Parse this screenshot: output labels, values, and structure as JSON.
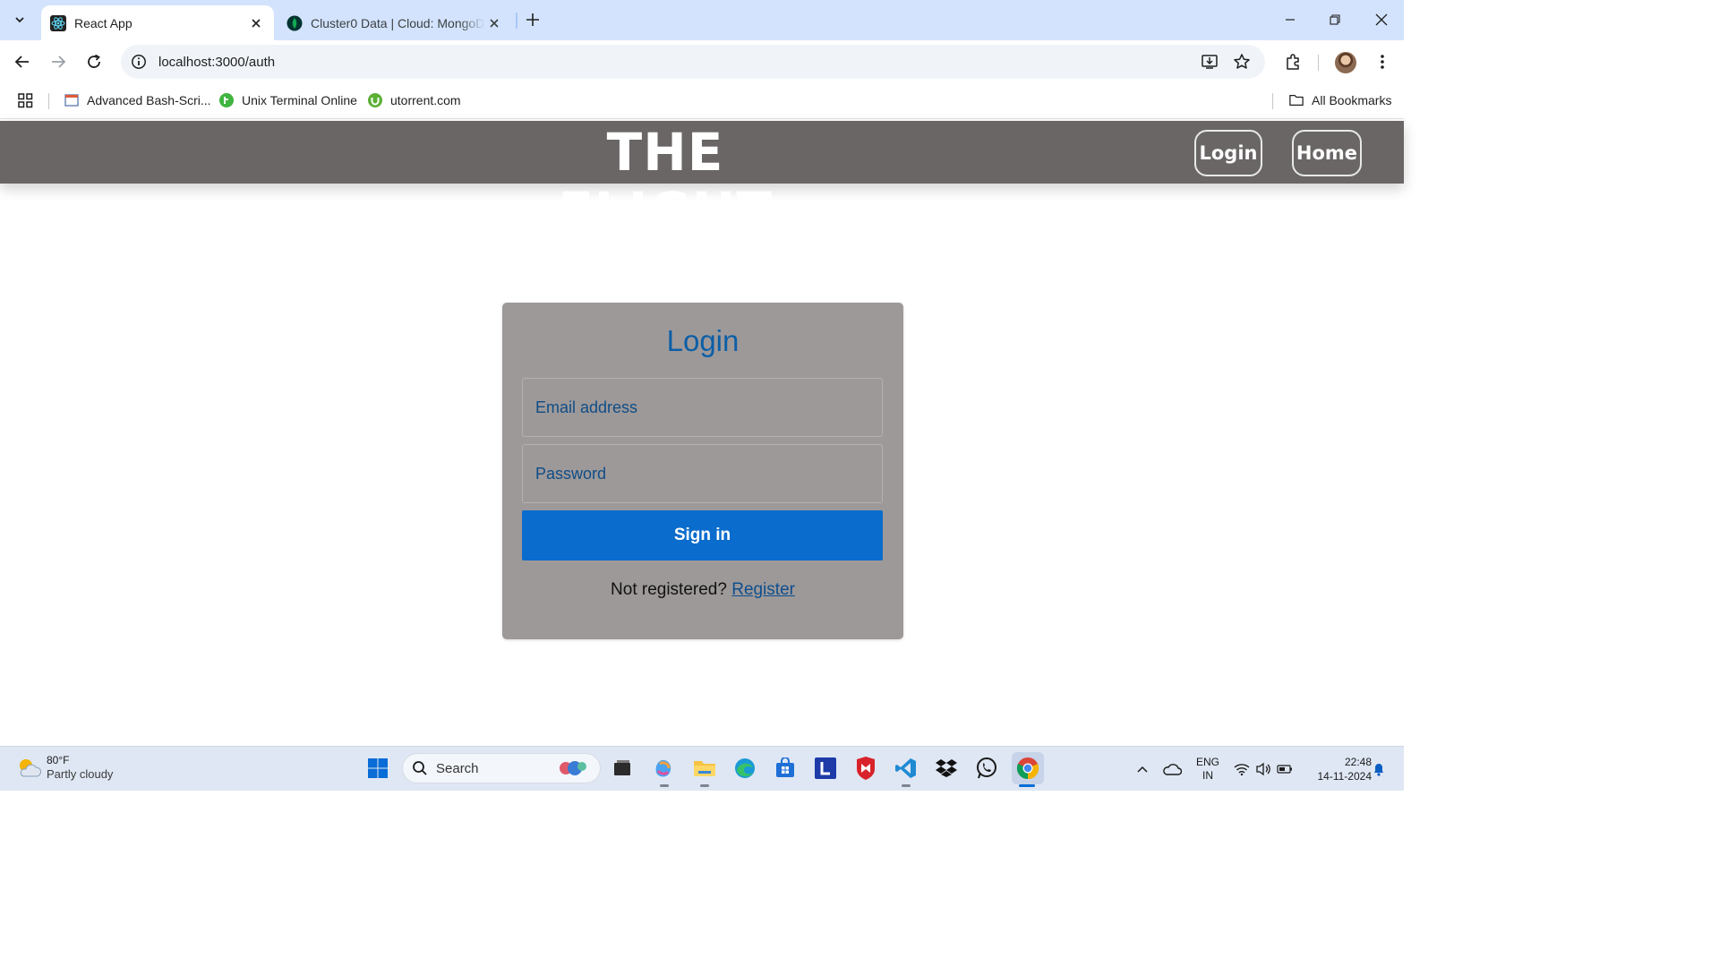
{
  "browser": {
    "tabs": [
      {
        "title": "React App",
        "active": true,
        "favicon": "react-icon"
      },
      {
        "title": "Cluster0 Data | Cloud: MongoDB",
        "active": false,
        "favicon": "mongodb-leaf-icon"
      }
    ],
    "url": "localhost:3000/auth",
    "bookmarks": [
      {
        "label": "Advanced Bash-Scri...",
        "icon": "page-icon"
      },
      {
        "label": "Unix Terminal Online",
        "icon": "tutorialspoint-icon"
      },
      {
        "label": "utorrent.com",
        "icon": "utorrent-icon"
      }
    ],
    "all_bookmarks_label": "All Bookmarks"
  },
  "app": {
    "brand": "THE FLIGHT",
    "nav": {
      "login": "Login",
      "home": "Home"
    },
    "colors": {
      "header": "#6a6666",
      "card": "#9e9999",
      "primary": "#0a6ccc",
      "title": "#0d5fa6"
    }
  },
  "login_form": {
    "title": "Login",
    "email_placeholder": "Email address",
    "password_placeholder": "Password",
    "submit_label": "Sign in",
    "register_prompt": "Not registered?",
    "register_link": "Register"
  },
  "taskbar": {
    "weather_temp": "80°F",
    "weather_desc": "Partly cloudy",
    "search_placeholder": "Search",
    "lang_top": "ENG",
    "lang_bottom": "IN",
    "time": "22:48",
    "date": "14-11-2024"
  }
}
